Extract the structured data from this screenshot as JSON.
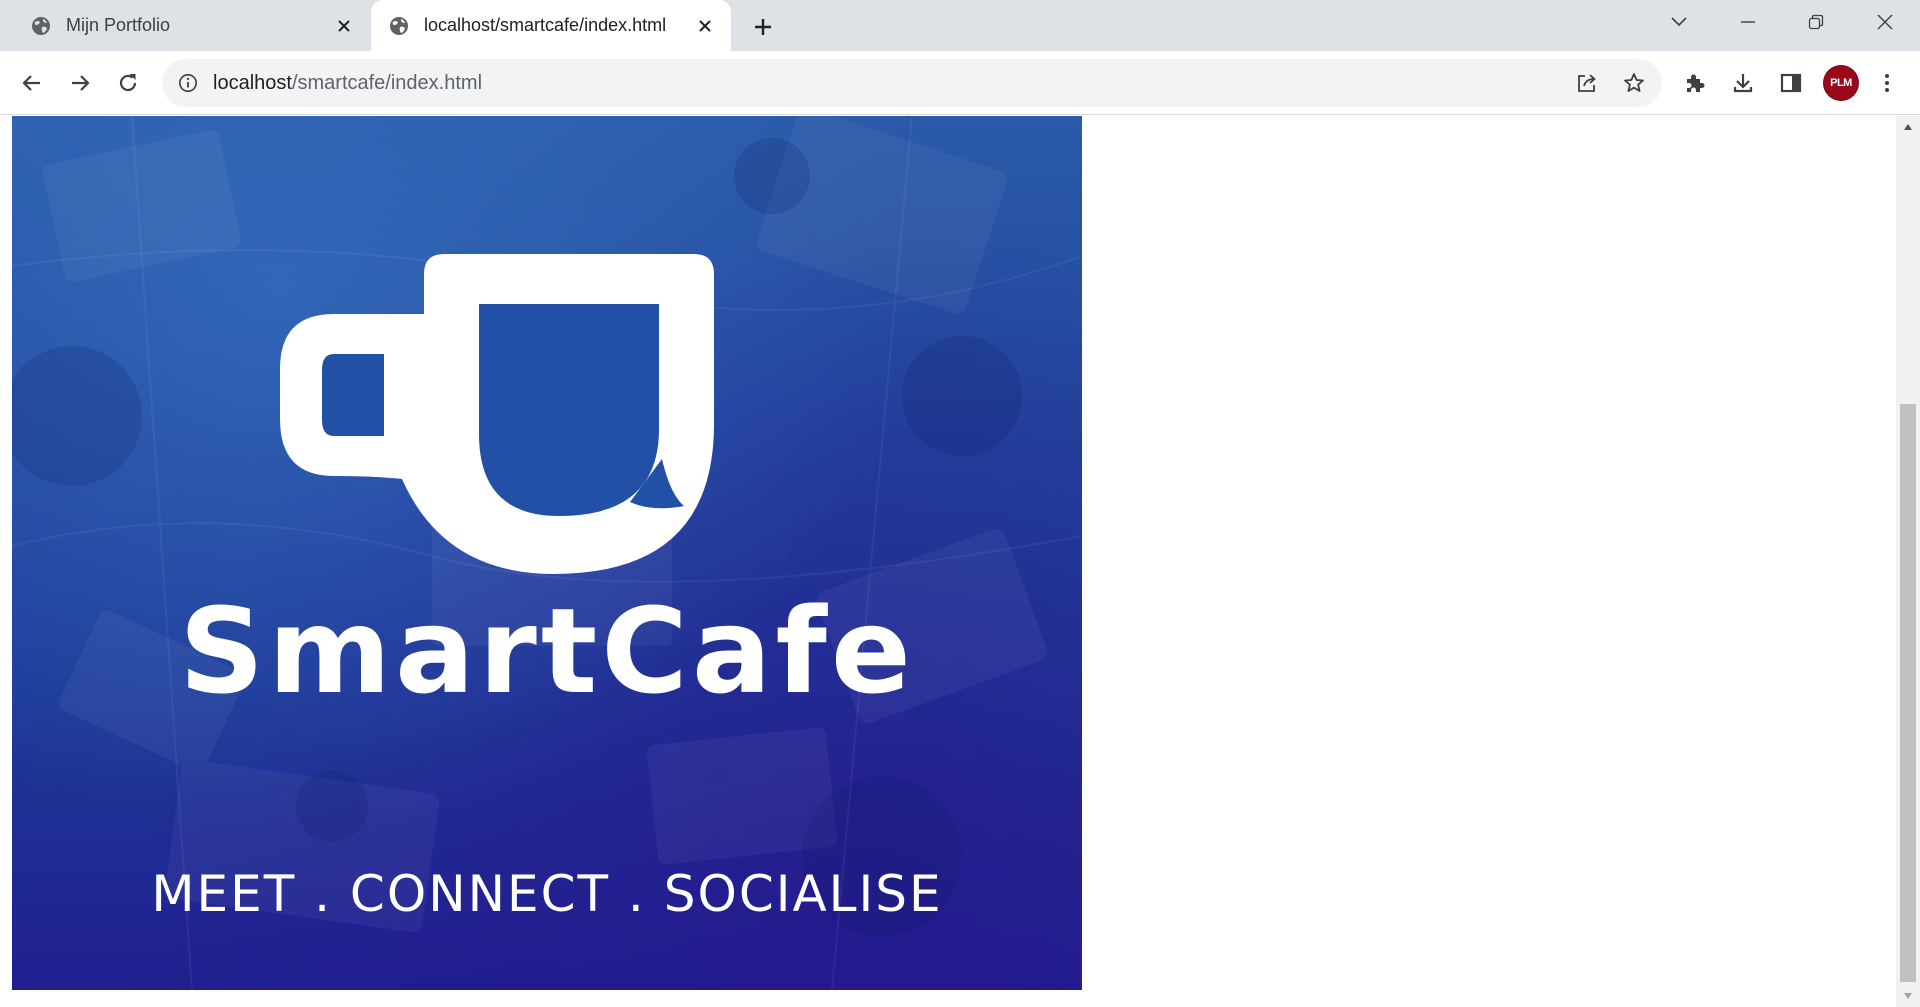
{
  "tabs": [
    {
      "title": "Mijn Portfolio",
      "active": false
    },
    {
      "title": "localhost/smartcafe/index.html",
      "active": true
    }
  ],
  "address_bar": {
    "host": "localhost",
    "path": "/smartcafe/index.html"
  },
  "profile": {
    "initials": "PLM",
    "color": "#9b0a1b"
  },
  "page": {
    "brand_name": "SmartCafe",
    "tagline": "MEET . CONNECT . SOCIALISE"
  },
  "icons": {
    "favicon": "globe-icon",
    "close": "close-icon",
    "new_tab": "plus-icon",
    "tab_search": "chevron-down-icon",
    "minimize": "minimize-icon",
    "restore": "restore-icon",
    "window_close": "close-icon",
    "back": "arrow-left-icon",
    "forward": "arrow-right-icon",
    "reload": "reload-icon",
    "site_info": "info-icon",
    "share": "share-icon",
    "bookmark": "star-icon",
    "extensions": "puzzle-icon",
    "downloads": "download-icon",
    "side_panel": "side-panel-icon",
    "menu": "kebab-menu-icon"
  },
  "colors": {
    "tabstrip": "#dee1e6",
    "hero_top": "#2a5aa8",
    "hero_bottom": "#201f8f",
    "logo": "#ffffff"
  }
}
